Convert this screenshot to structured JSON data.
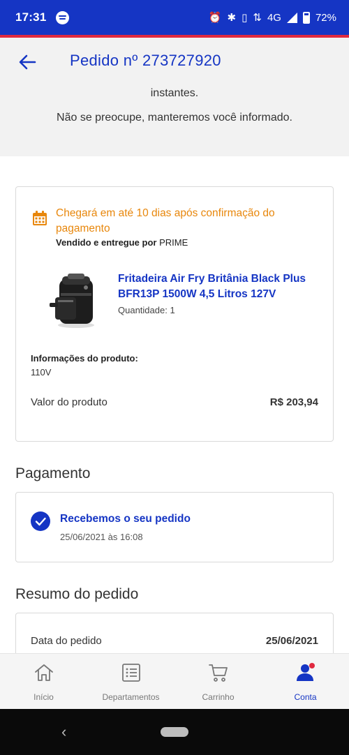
{
  "status_bar": {
    "time": "17:31",
    "network": "4G",
    "battery": "72%"
  },
  "header": {
    "title": "Pedido nº 273727920",
    "message_line1": "instantes.",
    "message_line2": "Não se preocupe, manteremos você informado."
  },
  "order": {
    "delivery_text": "Chegará em até 10 dias após confirmação do pagamento",
    "seller_prefix": "Vendido e entregue por",
    "seller_name": "PRIME",
    "product_name": "Fritadeira Air Fry Britânia Black Plus BFR13P 1500W 4,5 Litros 127V",
    "quantity": "Quantidade: 1",
    "info_label": "Informações do produto:",
    "info_value": "110V",
    "price_label": "Valor do produto",
    "price_value": "R$ 203,94"
  },
  "payment": {
    "section_title": "Pagamento",
    "status": "Recebemos o seu pedido",
    "date": "25/06/2021 às 16:08"
  },
  "summary": {
    "section_title": "Resumo do pedido",
    "date_label": "Data do pedido",
    "date_value": "25/06/2021"
  },
  "bottom_nav": {
    "items": [
      {
        "label": "Início",
        "icon": "home-icon"
      },
      {
        "label": "Departamentos",
        "icon": "list-icon"
      },
      {
        "label": "Carrinho",
        "icon": "cart-icon"
      },
      {
        "label": "Conta",
        "icon": "account-icon",
        "active": true
      }
    ]
  },
  "colors": {
    "brand_blue": "#1535c4",
    "accent_red": "#e0293f",
    "delivery_orange": "#e8870c"
  }
}
